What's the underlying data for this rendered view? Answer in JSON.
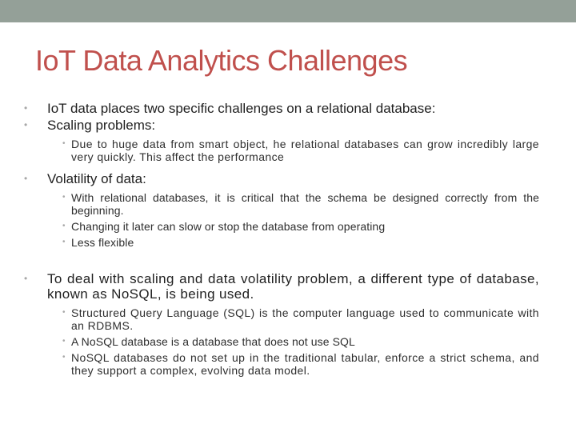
{
  "colors": {
    "top_bar": "#94a098",
    "title": "#c0504d",
    "body_text": "#1f1f1f",
    "sub_text": "#2e2e2e",
    "bullet": "#a8a8a8"
  },
  "slide": {
    "title": "IoT Data Analytics Challenges",
    "bullet_icon": "bullet-dot",
    "bullet_glyph": "•",
    "items": [
      {
        "text": "IoT data places two specific challenges on a relational database:",
        "children": []
      },
      {
        "text": "Scaling problems:",
        "children": [
          {
            "text": "Due to huge data from smart object, he relational databases can grow incredibly large very quickly. This affect the performance"
          }
        ]
      },
      {
        "text": "Volatility of data:",
        "children": [
          {
            "text": "With relational databases, it is critical that the schema be designed correctly from the beginning."
          },
          {
            "text": "Changing it later can slow or stop the database from operating"
          },
          {
            "text": "Less flexible"
          }
        ]
      },
      {
        "text": "To deal with scaling and data volatility problem, a different type of database, known as NoSQL, is being used.",
        "children": [
          {
            "text": "Structured Query Language (SQL) is the computer language used to communicate with an RDBMS."
          },
          {
            "text": "A NoSQL database is a database that does not use SQL"
          },
          {
            "text": "NoSQL databases do not set up in the traditional tabular, enforce a strict schema, and they support a complex, evolving data model."
          }
        ]
      }
    ]
  }
}
